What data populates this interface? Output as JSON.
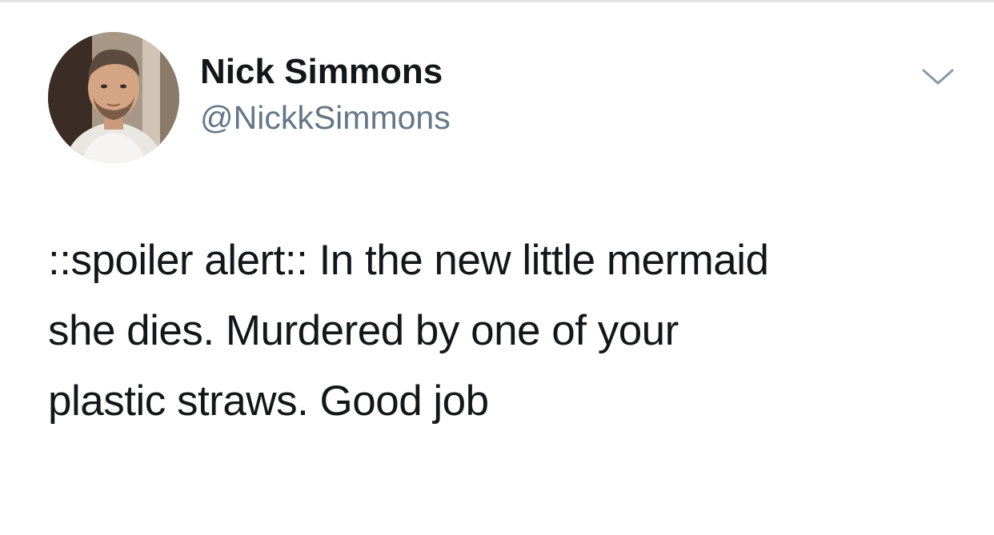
{
  "tweet": {
    "author": {
      "display_name": "Nick Simmons",
      "handle": "@NickkSimmons",
      "avatar_icon": "profile-photo"
    },
    "menu_icon": "chevron-down-icon",
    "text": "::spoiler alert:: In the new little mermaid\nshe dies. Murdered by one of your\nplastic straws. Good job"
  },
  "colors": {
    "name": "#14171a",
    "handle": "#657786",
    "chevron": "#8899a6",
    "background": "#ffffff"
  }
}
